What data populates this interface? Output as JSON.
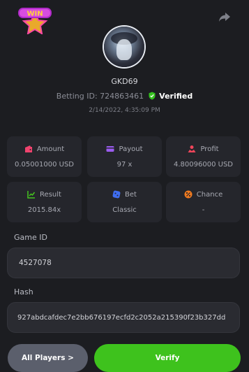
{
  "header": {
    "logo_text": "WIN"
  },
  "profile": {
    "username": "GKD69",
    "betting_id_label": "Betting ID:",
    "betting_id": "724863461",
    "verified_label": "Verified",
    "timestamp": "2/14/2022, 4:35:09 PM"
  },
  "stats": [
    {
      "label": "Amount",
      "value": "0.05001000 USD",
      "icon": "wallet-icon",
      "color": "#f0436e"
    },
    {
      "label": "Payout",
      "value": "97 x",
      "icon": "card-icon",
      "color": "#9b5cf0"
    },
    {
      "label": "Profit",
      "value": "4.80096000 USD",
      "icon": "profit-icon",
      "color": "#f0455a"
    },
    {
      "label": "Result",
      "value": "2015.84x",
      "icon": "chart-icon",
      "color": "#45c41f"
    },
    {
      "label": "Bet",
      "value": "Classic",
      "icon": "dice-icon",
      "color": "#3f6df0"
    },
    {
      "label": "Chance",
      "value": "-",
      "icon": "percent-icon",
      "color": "#f07a1f"
    }
  ],
  "game": {
    "game_id_label": "Game ID",
    "game_id": "4527078",
    "hash_label": "Hash",
    "hash": "927abdcafdec7e2bb676197ecfd2c2052a215390f23b327dd"
  },
  "actions": {
    "all_players_label": "All Players >",
    "verify_label": "Verify"
  }
}
